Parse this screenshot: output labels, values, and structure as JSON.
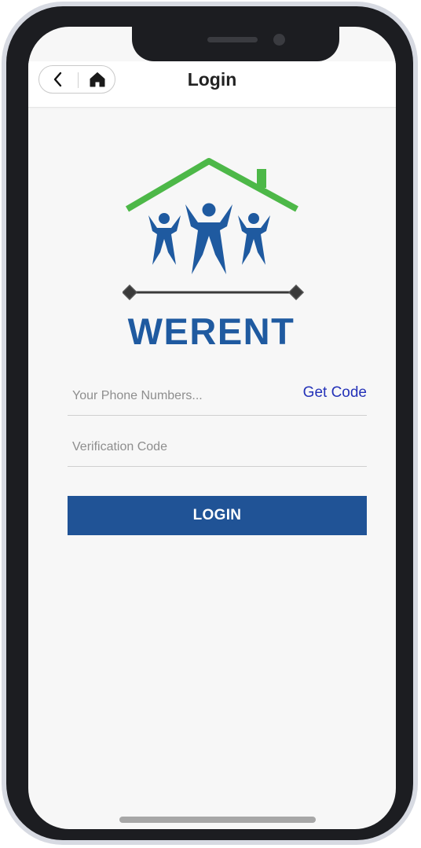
{
  "header": {
    "title": "Login",
    "back_icon": "chevron-left-icon",
    "home_icon": "home-icon"
  },
  "logo": {
    "brand_text": "WERENT",
    "colors": {
      "roof": "#4db848",
      "figures": "#1f5aa0",
      "bar": "#3a3a3a"
    }
  },
  "form": {
    "phone_placeholder": "Your Phone Numbers...",
    "get_code_label": "Get Code",
    "code_placeholder": "Verification Code",
    "login_label": "LOGIN"
  },
  "colors": {
    "accent": "#205396",
    "link": "#2432b8"
  }
}
